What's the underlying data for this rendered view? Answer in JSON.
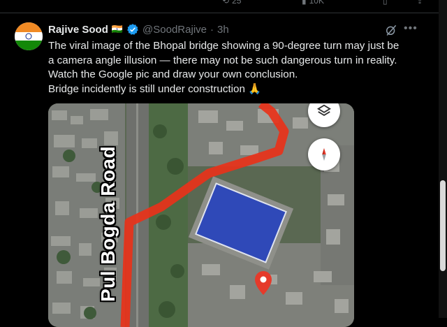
{
  "top_metrics": [
    "25",
    "10K"
  ],
  "tweet": {
    "display_name": "Rajive Sood",
    "flag_emoji": "🇮🇳",
    "handle": "@SoodRajive",
    "separator": "·",
    "time": "3h",
    "lines": [
      "The viral image of the Bhopal bridge showing a 90-degree turn may just be",
      "a camera angle illusion — there may not be  such dangerous turn in reality.",
      "Watch the Google pic and draw your own conclusion.",
      "Bridge incidently is still under construction 🙏"
    ]
  },
  "media": {
    "road_label": "Pul Bogda Road",
    "icons": [
      "layers-icon",
      "compass-icon",
      "location-pin-icon"
    ]
  },
  "colors": {
    "background": "#000000",
    "verified_badge": "#1d9bf0",
    "bridge_overlay": "#e8321a",
    "field_blue": "#2f49b8"
  }
}
